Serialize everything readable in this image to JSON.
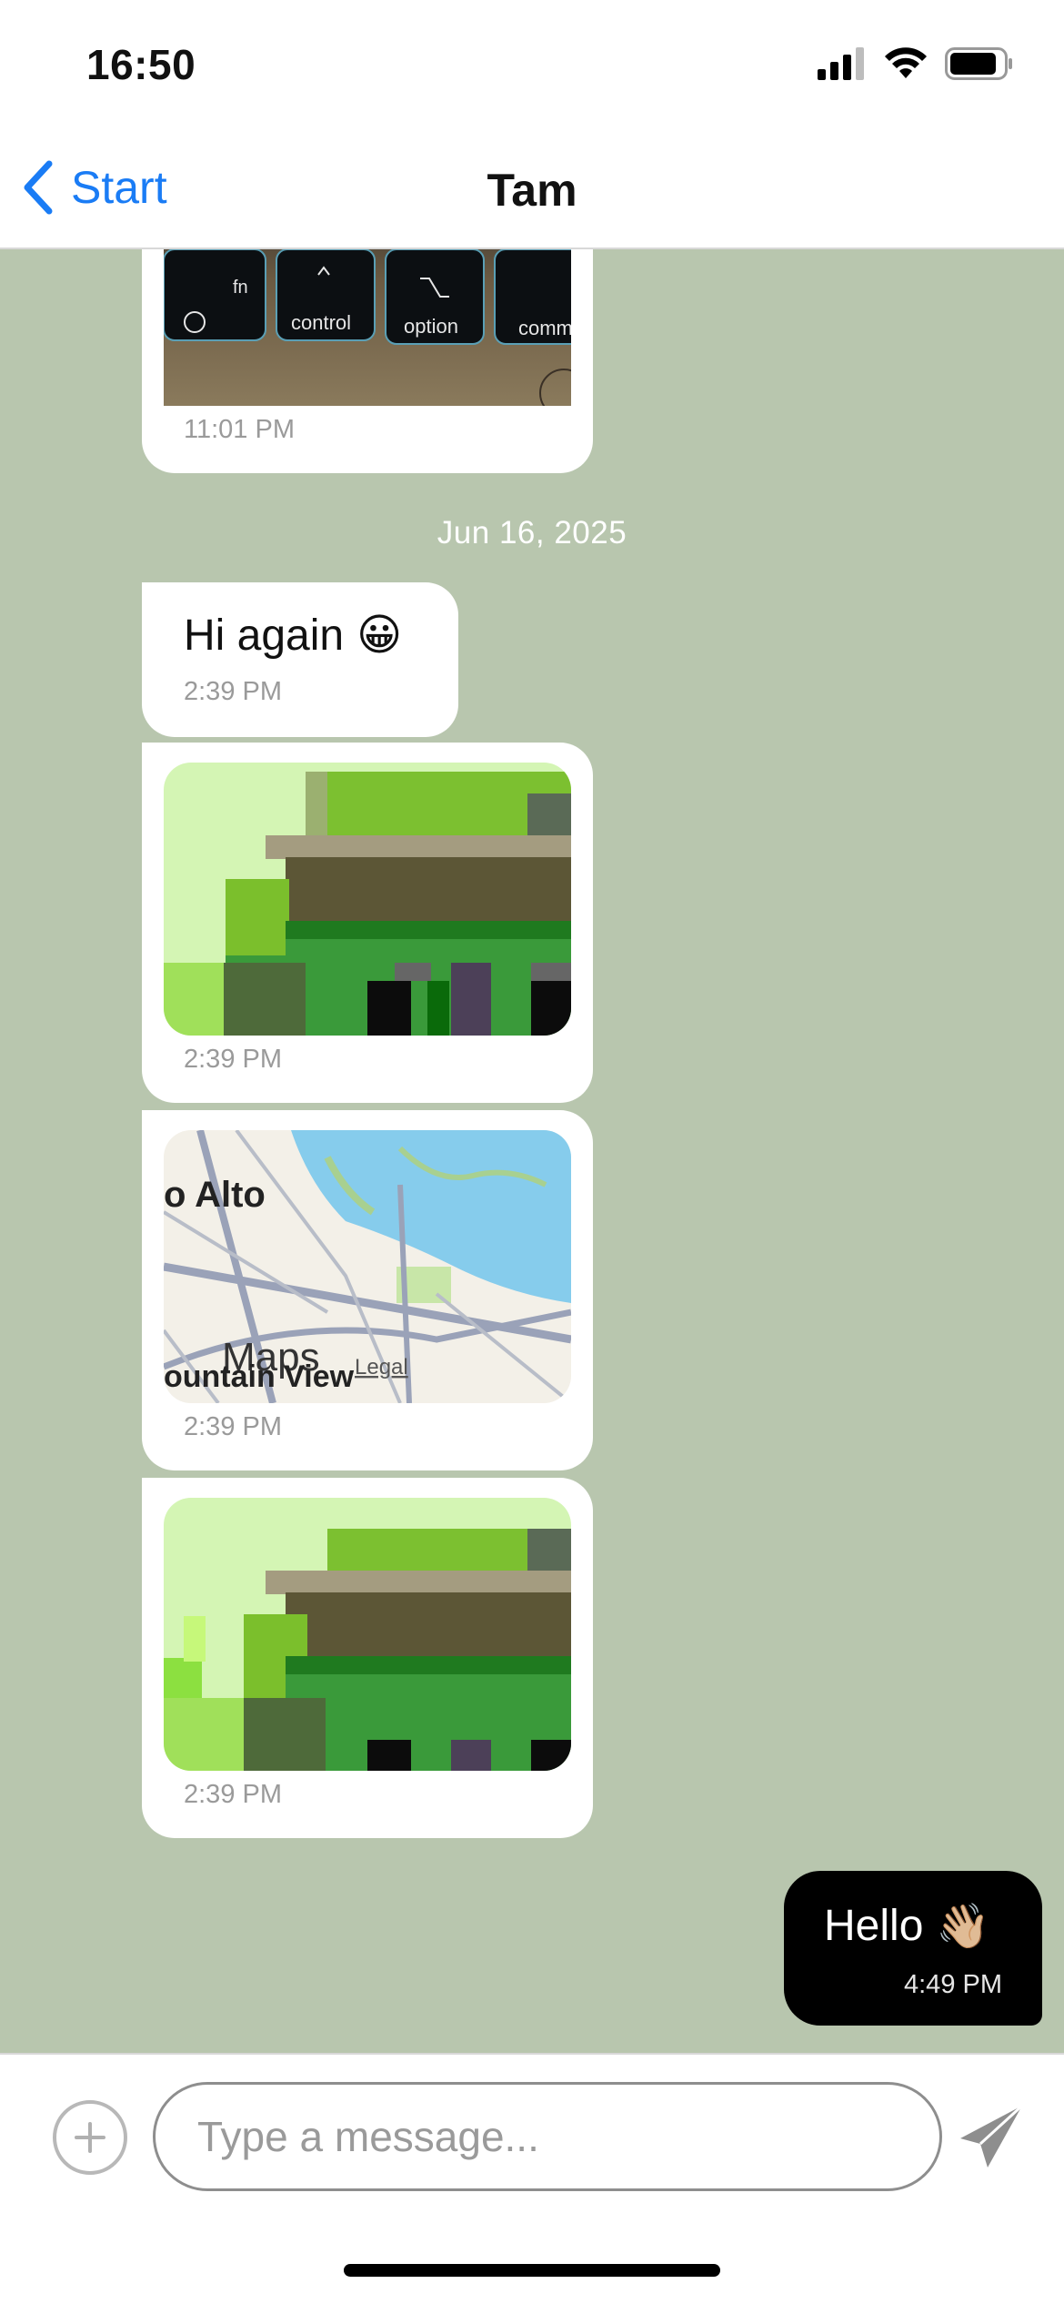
{
  "status_bar": {
    "time": "16:50",
    "icons": [
      "signal-icon",
      "wifi-icon",
      "battery-icon"
    ]
  },
  "nav": {
    "back_label": "Start",
    "title": "Tam"
  },
  "date_separator": "Jun 16, 2025",
  "messages": [
    {
      "type": "image",
      "direction": "incoming",
      "image": "keyboard-photo",
      "key_labels": [
        "fn",
        "control",
        "option",
        "comm"
      ],
      "time": "11:01 PM"
    },
    {
      "type": "text",
      "direction": "incoming",
      "text": "Hi again",
      "emoji": "😀",
      "time": "2:39 PM"
    },
    {
      "type": "image",
      "direction": "incoming",
      "image": "pixelated-sticker",
      "time": "2:39 PM"
    },
    {
      "type": "map",
      "direction": "incoming",
      "labels": {
        "city_top": "o Alto",
        "city_bottom": "ountain View",
        "attribution": "Maps",
        "legal": "Legal"
      },
      "time": "2:39 PM"
    },
    {
      "type": "image",
      "direction": "incoming",
      "image": "pixelated-sticker",
      "time": "2:39 PM"
    },
    {
      "type": "text",
      "direction": "outgoing",
      "text": "Hello",
      "emoji": "👋🏼",
      "time": "4:49 PM"
    }
  ],
  "composer": {
    "placeholder": "Type a message..."
  },
  "colors": {
    "accent": "#1a7cf5",
    "chat_background": "#b8c6ae",
    "incoming_bubble": "#ffffff",
    "outgoing_bubble": "#000000"
  }
}
